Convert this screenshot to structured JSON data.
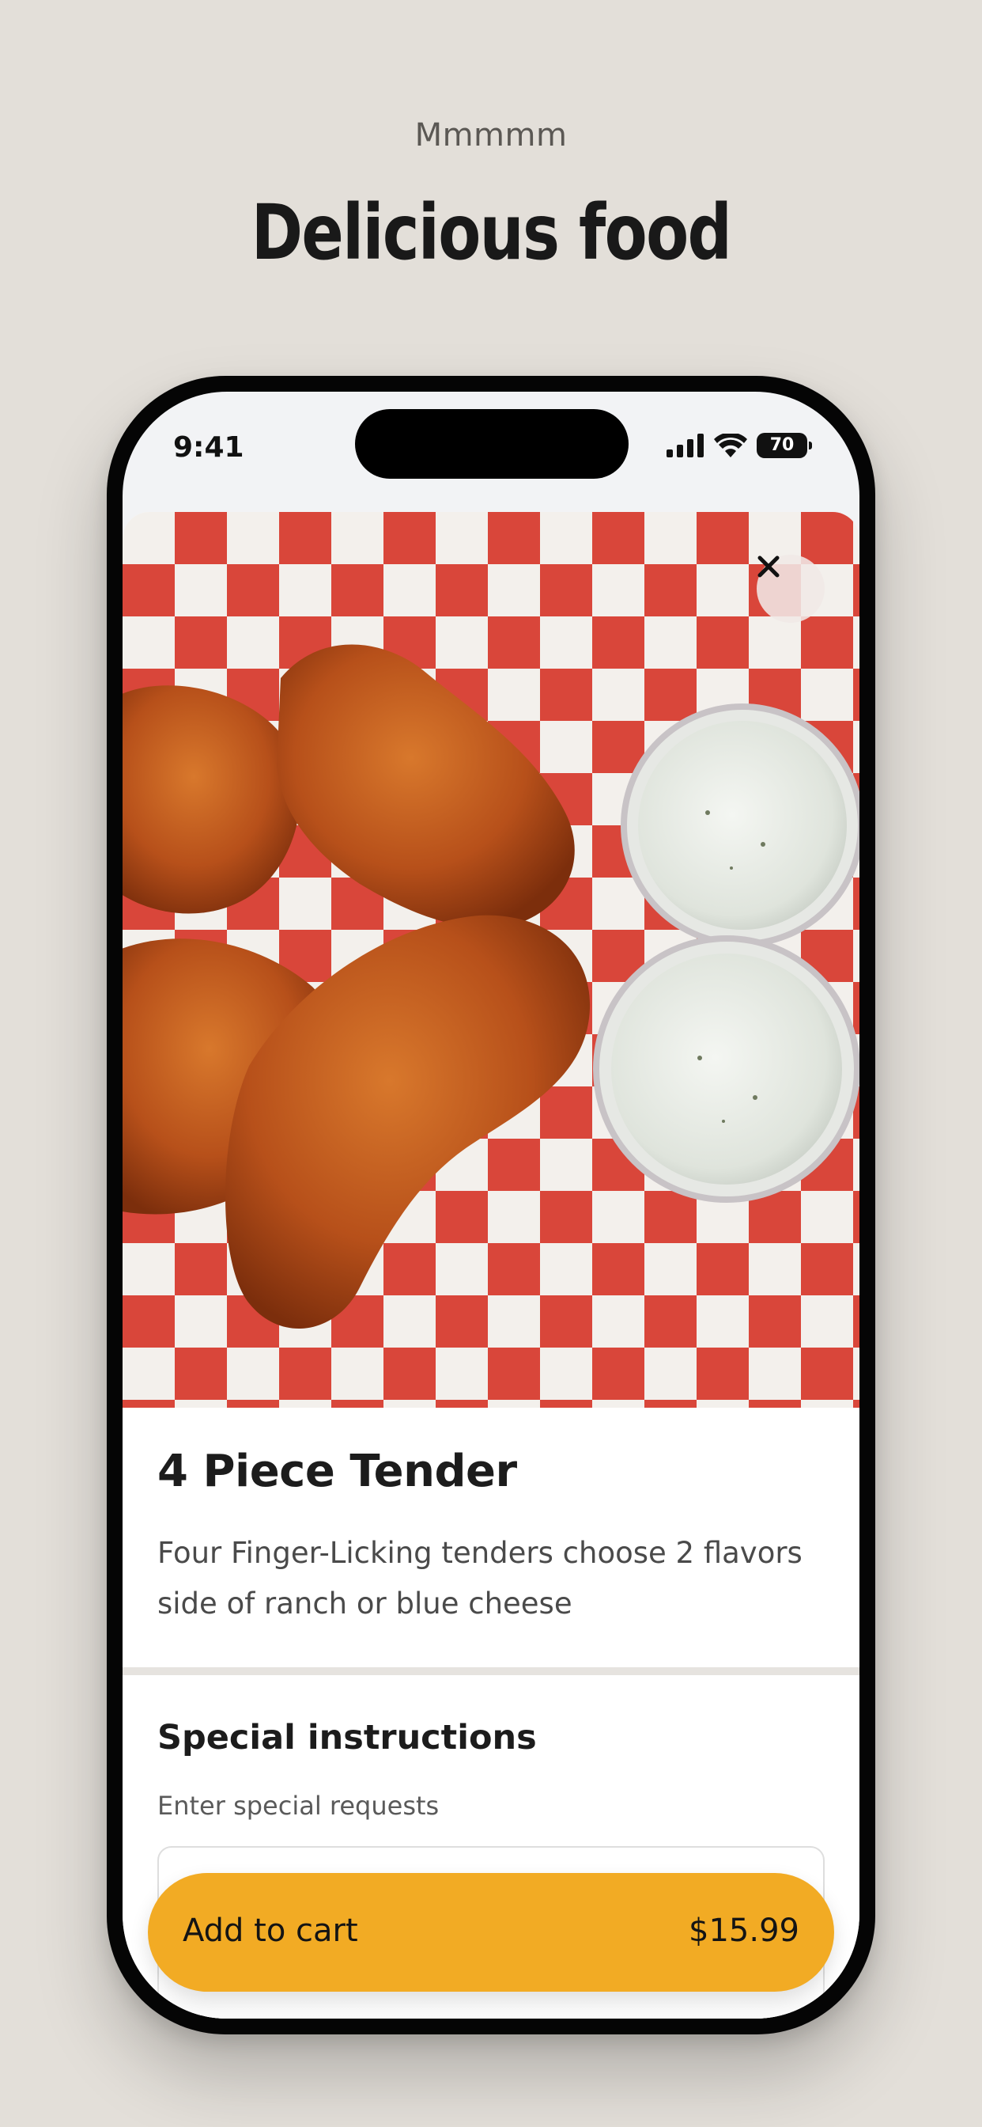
{
  "header": {
    "eyebrow": "Mmmmm",
    "title": "Delicious food"
  },
  "status_bar": {
    "time": "9:41",
    "battery": "70",
    "icons": [
      "cellular-signal-icon",
      "wifi-icon",
      "battery-icon"
    ]
  },
  "item": {
    "image_alt": "Fried chicken tenders with two cups of ranch dressing on red checkered paper",
    "title": "4 Piece Tender",
    "description": "Four Finger-Licking tenders choose 2 flavors side of ranch or blue cheese"
  },
  "special_instructions": {
    "title": "Special instructions",
    "hint": "Enter special requests",
    "value": ""
  },
  "cart_button": {
    "label": "Add to cart",
    "price": "$15.99"
  },
  "colors": {
    "background": "#e3dfd9",
    "accent": "#f2ab24",
    "checker_red": "#d9463a"
  }
}
